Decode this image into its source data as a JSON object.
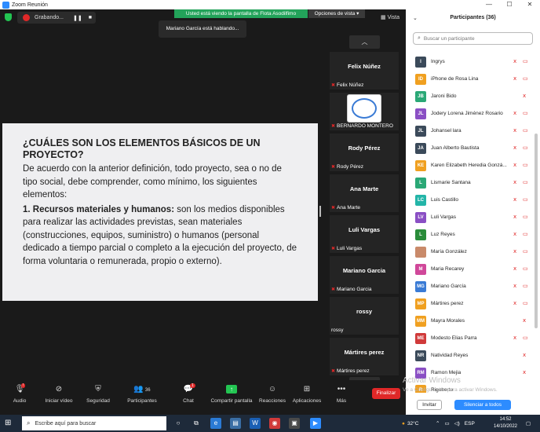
{
  "window": {
    "title": "Zoom Reunión",
    "controls": [
      "—",
      "☐",
      "✕"
    ]
  },
  "topbar": {
    "recording_label": "Grabando...",
    "pause_icon": "❚❚",
    "stop_icon": "■",
    "sharing_banner": "Usted está viendo la pantalla de Flota Asodilfimo",
    "view_options": "Opciones de vista ▾",
    "speaking": "Mariano García está hablando...",
    "view_label": "Vista"
  },
  "slide": {
    "heading": "¿CUÁLES SON LOS ELEMENTOS BÁSICOS DE UN PROYECTO?",
    "para1": "De acuerdo con la anterior definición, todo proyecto, sea o no de tipo social, debe comprender, como mínimo, los siguientes elementos:",
    "point_title": "1. Recursos materiales y humanos:",
    "point_body": " son los medios disponibles para realizar las actividades previstas, sean materiales (construcciones, equipos, suministro) o humanos (personal dedicado a tiempo parcial o completo a la ejecución del proyecto, de forma voluntaria o remunerada, propio o externo)."
  },
  "gallery": {
    "up": "︿",
    "down": "﹀",
    "tiles": [
      {
        "name": "Felix Núñez",
        "label": "Felix Núñez"
      },
      {
        "name": "",
        "label": "BERNARDO MONTERO"
      },
      {
        "name": "Rody Pérez",
        "label": "Rody Pérez"
      },
      {
        "name": "Ana Marte",
        "label": "Ana Marte"
      },
      {
        "name": "Luli Vargas",
        "label": "Luli Vargas"
      },
      {
        "name": "Mariano Garcia",
        "label": "Mariano Garcia"
      },
      {
        "name": "rossy",
        "label": "rossy"
      },
      {
        "name": "Mártires perez",
        "label": "Mártires perez"
      }
    ]
  },
  "toolbar": {
    "audio": "Audio",
    "video": "Iniciar vídeo",
    "security": "Seguridad",
    "participants": "Participantes",
    "participants_count": "36",
    "chat": "Chat",
    "chat_badge": "1",
    "share": "Compartir pantalla",
    "reactions": "Reacciones",
    "apps": "Aplicaciones",
    "more": "Más",
    "end": "Finalizar"
  },
  "panel": {
    "title": "Participantes (36)",
    "search_placeholder": "Buscar un participante",
    "invite": "Invitar",
    "mute_all": "Silenciar a todos",
    "participants": [
      {
        "initials": "I",
        "name": "Ingrys",
        "color": "#3b4a5a",
        "cam": true
      },
      {
        "initials": "ID",
        "name": "iPhone de Rosa Lina",
        "color": "#f0a020",
        "cam": true
      },
      {
        "initials": "JB",
        "name": "Jaroni Bido",
        "color": "#2aa876",
        "cam": false
      },
      {
        "initials": "JL",
        "name": "Jodery Lorena Jiménez Rosario",
        "color": "#8a4fc4",
        "cam": true
      },
      {
        "initials": "JL",
        "name": "Johansel lara",
        "color": "#3b4a5a",
        "cam": true
      },
      {
        "initials": "JA",
        "name": "Juan Alberto Bautista",
        "color": "#3b4a5a",
        "cam": true
      },
      {
        "initials": "KE",
        "name": "Karen Elizabeth Heredia Gonzá...",
        "color": "#f0a020",
        "cam": true
      },
      {
        "initials": "L",
        "name": "Lismarie Santana",
        "color": "#2aa876",
        "cam": true
      },
      {
        "initials": "LC",
        "name": "Luis Castillo",
        "color": "#23b5a8",
        "cam": true
      },
      {
        "initials": "LV",
        "name": "Luli Vargas",
        "color": "#8a4fc4",
        "cam": true
      },
      {
        "initials": "L",
        "name": "Luz Reyes",
        "color": "#2a8c3a",
        "cam": true
      },
      {
        "initials": "",
        "name": "María González",
        "color": "#c98a6a",
        "cam": true
      },
      {
        "initials": "M",
        "name": "Maria Recarey",
        "color": "#d0489a",
        "cam": true
      },
      {
        "initials": "MG",
        "name": "Mariano García",
        "color": "#3a7bd5",
        "cam": true
      },
      {
        "initials": "MP",
        "name": "Mártires perez",
        "color": "#f0a020",
        "cam": true
      },
      {
        "initials": "MM",
        "name": "Mayra Morales",
        "color": "#f0a020",
        "cam": false
      },
      {
        "initials": "ME",
        "name": "Modesto Elias Parra",
        "color": "#d03a3a",
        "cam": true
      },
      {
        "initials": "NR",
        "name": "Natividad Reyes",
        "color": "#3b4a5a",
        "cam": false
      },
      {
        "initials": "RM",
        "name": "Ramon Mejia",
        "color": "#8a4fc4",
        "cam": false
      },
      {
        "initials": "R",
        "name": "Rigoberto",
        "color": "#f0a020",
        "cam": false
      }
    ]
  },
  "watermark": {
    "line1": "Activar Windows",
    "line2": "Ve a Configuración para activar Windows."
  },
  "taskbar": {
    "search_placeholder": "Escribe aquí para buscar",
    "temperature": "32°C",
    "language": "ESP",
    "time": "14:52",
    "date": "14/10/2022"
  }
}
